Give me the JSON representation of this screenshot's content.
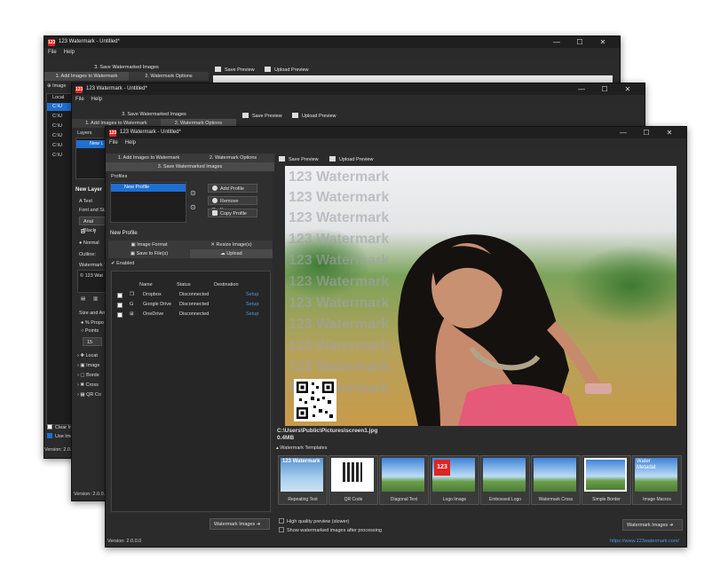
{
  "app": {
    "title_back": "123 Watermark - Untitled*",
    "title_front": "123 Watermark - Untitled*",
    "logo": "123"
  },
  "window_controls": {
    "minimize": "—",
    "maximize": "☐",
    "close": "✕"
  },
  "menu": {
    "file": "File",
    "help": "Help"
  },
  "tabs": {
    "save": "3. Save Watermarked Images",
    "add": "1. Add Images to Watermark",
    "options": "2. Watermark Options"
  },
  "toolbar": {
    "save_preview": "Save Preview",
    "upload_preview": "Upload Preview"
  },
  "back1": {
    "image_btn": "Image",
    "files": [
      "Local",
      "C:\\U",
      "C:\\U",
      "C:\\U",
      "C:\\U",
      "C:\\U",
      "C:\\U"
    ],
    "clear": "Clear Im",
    "use": "Use Ima",
    "version": "Version: 2.0.0"
  },
  "back2": {
    "layers": "Layers",
    "layer_item": "New L",
    "new_layer": "New Layer",
    "text": "Text",
    "font_size": "Font and Size",
    "font": "Arial Black",
    "bold": "B",
    "italic": "I",
    "normal": "Normal",
    "outline": "Outline:",
    "watermark_text": "Watermark T",
    "text_value": "© 123 Wat",
    "size_angle": "Size and Ang",
    "proportional": "% Propo",
    "points": "Points",
    "size_value": "15",
    "sections": [
      "Locat",
      "Image",
      "Borde",
      "Cross",
      "QR Co"
    ],
    "version": "Version: 2.0.0.0"
  },
  "front": {
    "profiles_label": "Profiles",
    "profile_item": "New Profile",
    "add_profile": "Add Profile",
    "remove_profile": "Remove Profile",
    "copy_profile": "Copy Profile",
    "new_profile_hdr": "New Profile",
    "subtab_format": "Image Format",
    "subtab_resize": "Resize Image(s)",
    "subtab_save": "Save to File(s)",
    "subtab_upload": "Upload",
    "enabled": "Enabled",
    "table_headers": [
      "Name",
      "Status",
      "Destination"
    ],
    "table_rows": [
      {
        "name": "Dropbox",
        "status": "Disconnected",
        "dest": "Setup"
      },
      {
        "name": "Google Drive",
        "status": "Disconnected",
        "dest": "Setup"
      },
      {
        "name": "OneDrive",
        "status": "Disconnected",
        "dest": "Setup"
      }
    ],
    "watermark_images_btn": "Watermark Images",
    "watermark_text": "123 Watermark",
    "file_path": "C:\\Users\\Public\\Pictures\\screen1.jpg",
    "file_size": "0.4MB",
    "templates_label": "Watermark Templates",
    "templates": [
      {
        "cap": "Repeating Text",
        "overlay": "123 Watermark"
      },
      {
        "cap": "QR Code",
        "overlay": ""
      },
      {
        "cap": "Diagonal Text",
        "overlay": ""
      },
      {
        "cap": "Logo Image",
        "overlay": "123"
      },
      {
        "cap": "Embossed Logo",
        "overlay": ""
      },
      {
        "cap": "Watermark Cross",
        "overlay": ""
      },
      {
        "cap": "Simple Border",
        "overlay": ""
      },
      {
        "cap": "Image Macros",
        "overlay": "Water Metadat"
      }
    ],
    "hq_preview": "High quality preview (slower)",
    "show_watermarked": "Show watermarked images after processing",
    "version": "Version: 2.0.0.0",
    "url": "https://www.123watermark.com/"
  }
}
